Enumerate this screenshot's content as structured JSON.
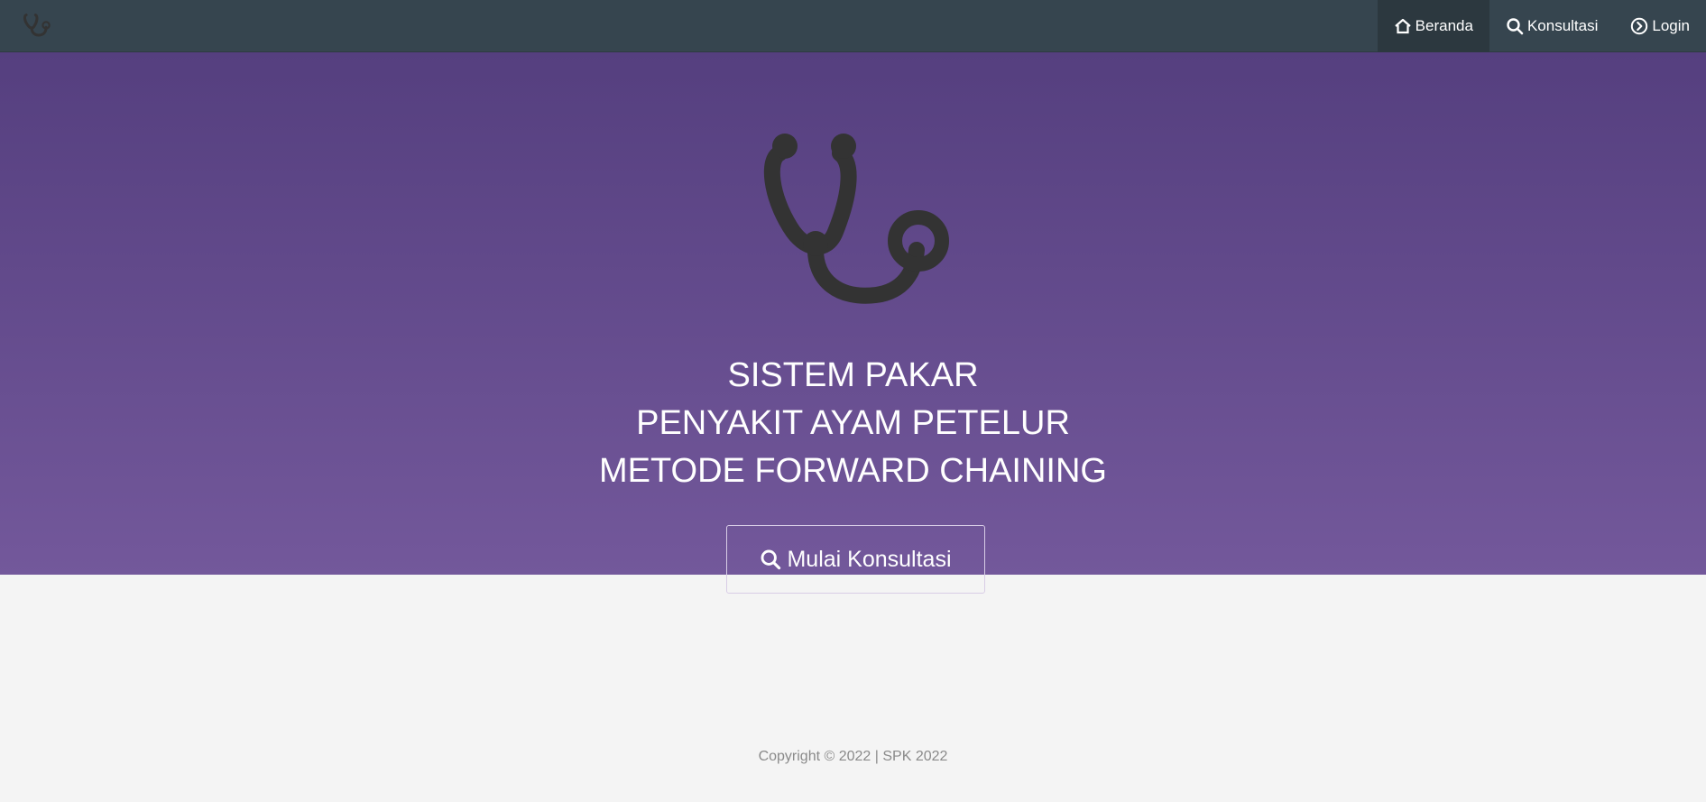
{
  "navbar": {
    "brand_icon": "stethoscope-icon",
    "items": [
      {
        "label": "Beranda",
        "icon": "home-icon",
        "active": true
      },
      {
        "label": "Konsultasi",
        "icon": "search-icon",
        "active": false
      },
      {
        "label": "Login",
        "icon": "chevron-circle-right-icon",
        "active": false
      }
    ]
  },
  "hero": {
    "icon": "stethoscope-icon",
    "title_lines": [
      "SISTEM PAKAR",
      "PENYAKIT AYAM PETELUR",
      "METODE FORWARD CHAINING"
    ],
    "cta_label": "Mulai Konsultasi",
    "cta_icon": "search-icon"
  },
  "footer": {
    "text": "Copyright © 2022 | SPK 2022"
  },
  "colors": {
    "navbar": "#36454f",
    "hero_top": "#553f7f",
    "hero_bottom": "#73589b",
    "icon": "#333333",
    "page_bg": "#f4f4f4"
  }
}
